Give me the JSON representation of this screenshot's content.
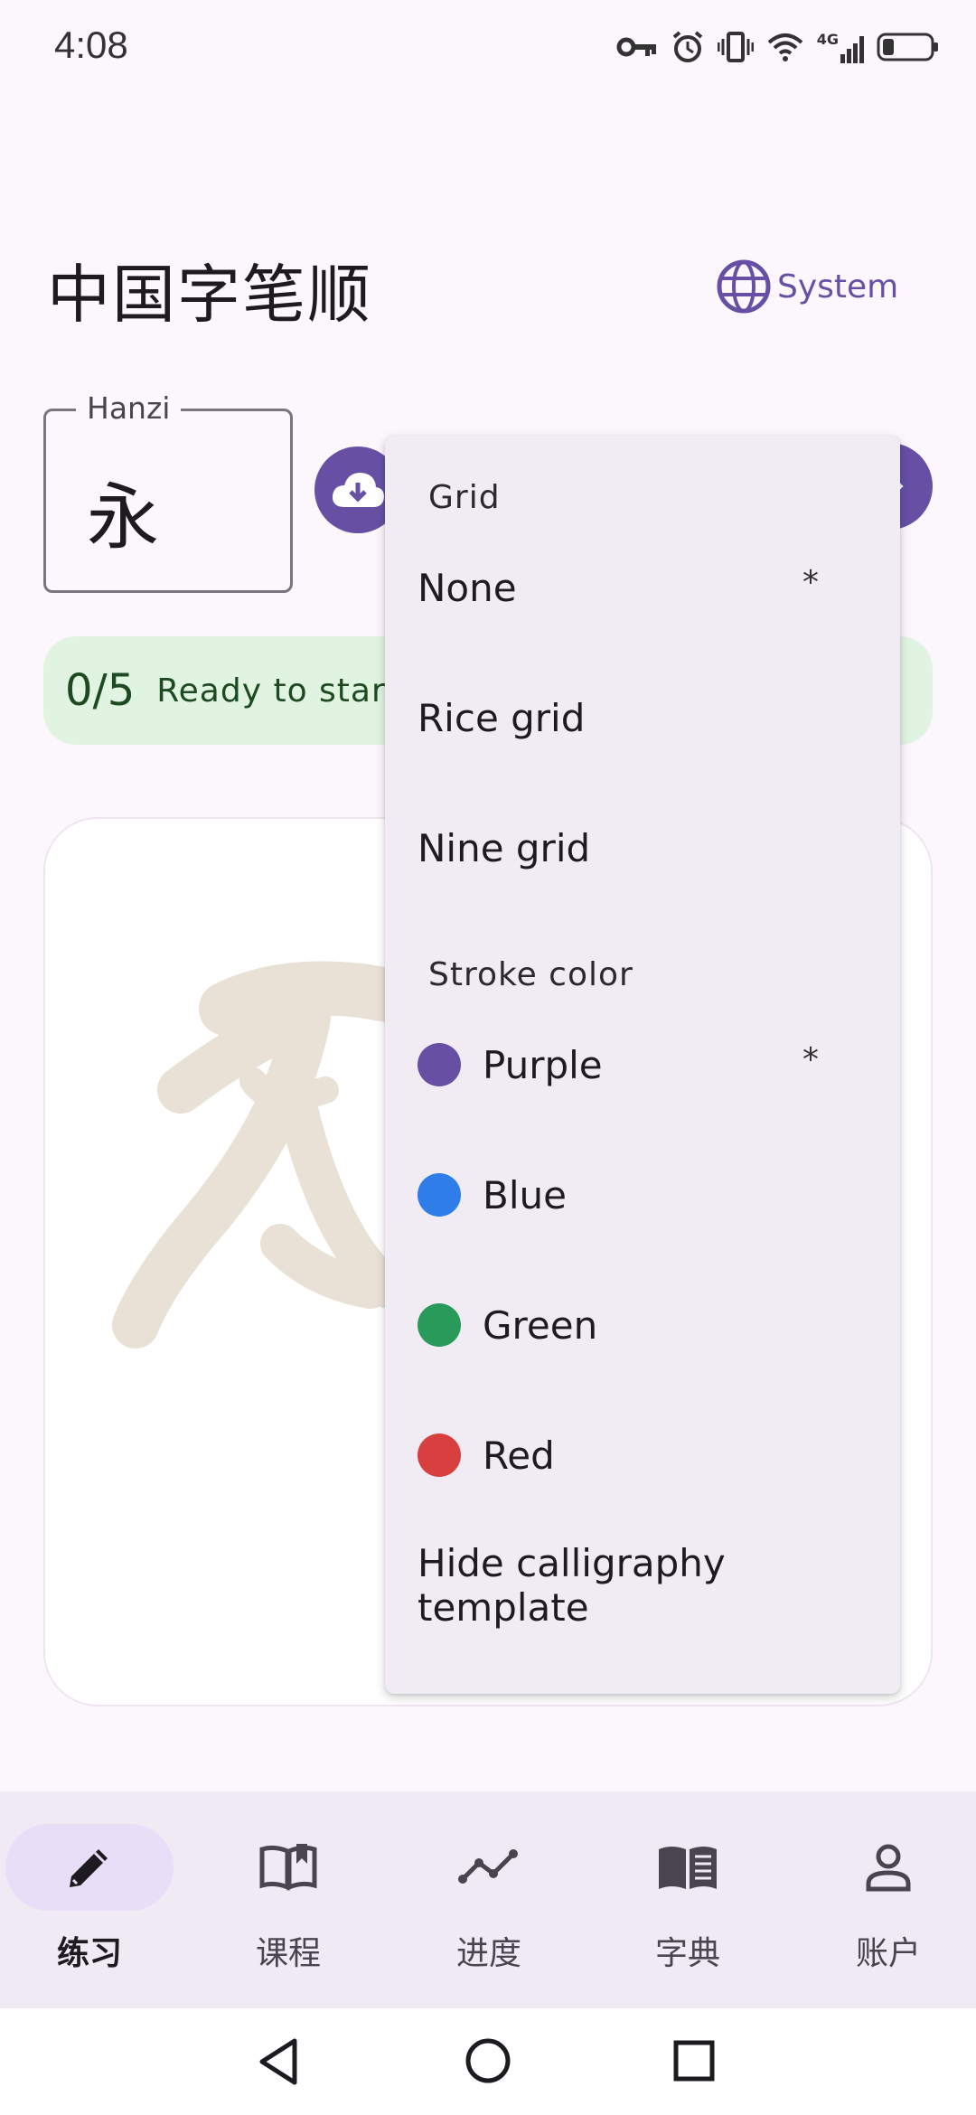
{
  "status_bar": {
    "time": "4:08",
    "icons": [
      "vpn-key-icon",
      "alarm-icon",
      "vibrate-icon",
      "wifi-icon",
      "signal-4g-icon",
      "battery-icon"
    ],
    "network_label": "4G"
  },
  "header": {
    "title": "中国字笔顺",
    "language_label": "System",
    "language_icon": "globe-icon"
  },
  "hanzi_input": {
    "label": "Hanzi",
    "value": "永"
  },
  "progress": {
    "count": "0/5",
    "status": "Ready to start"
  },
  "menu": {
    "grid_header": "Grid",
    "grid_options": [
      {
        "label": "None",
        "mark": "*"
      },
      {
        "label": "Rice grid",
        "mark": ""
      },
      {
        "label": "Nine grid",
        "mark": ""
      }
    ],
    "stroke_header": "Stroke color",
    "stroke_options": [
      {
        "label": "Purple",
        "mark": "*",
        "color": "#6750a4"
      },
      {
        "label": "Blue",
        "mark": "",
        "color": "#2e7de9"
      },
      {
        "label": "Green",
        "mark": "",
        "color": "#2a9a5a"
      },
      {
        "label": "Red",
        "mark": "",
        "color": "#d84040"
      }
    ],
    "template_toggle": "Hide calligraphy template"
  },
  "bottom_nav": {
    "items": [
      {
        "label": "练习",
        "icon": "pencil-icon",
        "active": true
      },
      {
        "label": "课程",
        "icon": "book-open-icon",
        "active": false
      },
      {
        "label": "进度",
        "icon": "trend-line-icon",
        "active": false
      },
      {
        "label": "字典",
        "icon": "dictionary-icon",
        "active": false
      },
      {
        "label": "账户",
        "icon": "person-icon",
        "active": false
      }
    ]
  },
  "colors": {
    "accent": "#6750a4",
    "progress_bg": "#e0f4e1",
    "menu_bg": "#f1ecf4",
    "template_stroke": "#e9e0d6"
  }
}
